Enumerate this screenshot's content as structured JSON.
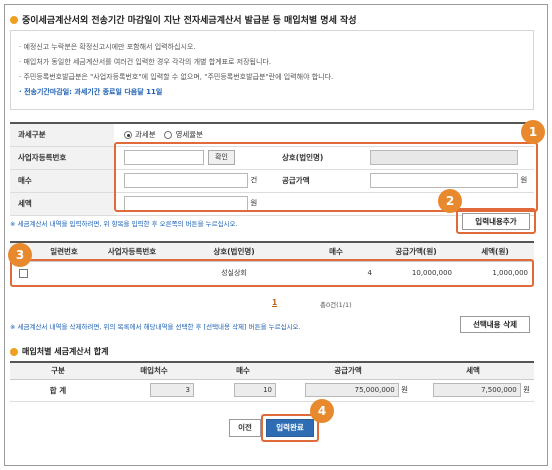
{
  "page_title": "중이세금계산서외 전송기간 마감일이 지난 전자세금계산서 발급분 등 매입처별 명세 작성",
  "notice": [
    "· 예정신고 누락분은 확정신고시에만 포함해서 입력하십시오.",
    "· 매입처가 동일한 세금계산서를 여러건 입력한 경우 각각의 개별 합계표로 저장됩니다.",
    "· 주민등록번호발급분은 \"사업자등록번호\"에 입력할 수 없으며, \"주민등록번호발급분\"란에 입력해야 합니다.",
    "· 전송기간마감일: 과세기간 종료일 다음달 11일"
  ],
  "form": {
    "tax_type_label": "과세구분",
    "tax_opt1": "과세분",
    "tax_opt2": "영세율분",
    "biz_no_label": "사업자등록번호",
    "confirm_btn": "확인",
    "company_label": "상호(법인명)",
    "count_label": "매수",
    "count_unit": "건",
    "supply_label": "공급가액",
    "supply_unit": "원",
    "tax_label": "세액",
    "tax_unit": "원"
  },
  "hint_add": "※ 세금계산서 내역을 입력하려면, 위 항목을 입력한 후 오른쪽의 버튼을 누르십시오.",
  "add_button": "입력내용추가",
  "list": {
    "headers": [
      "",
      "일련번호",
      "사업자등록번호",
      "상호(법인명)",
      "매수",
      "공급가액(원)",
      "세액(원)"
    ],
    "rows": [
      {
        "serial": "",
        "biz_no": "",
        "company": "성실상회",
        "count": "4",
        "supply": "10,000,000",
        "tax": "1,000,000"
      }
    ]
  },
  "pager_page": "1",
  "total_count": "총0건(1/1)",
  "hint_delete": "※ 세금계산서 내역을 삭제하려면, 위의 목록에서 해당내역을 선택한 후 [선택내용 삭제] 버튼을 누르십시오.",
  "delete_button": "선택내용 삭제",
  "summary": {
    "title": "매입처별 세금계산서 합계",
    "headers": [
      "구분",
      "매입처수",
      "매수",
      "공급가액",
      "세액"
    ],
    "row_label": "합 계",
    "vendors": "3",
    "count": "10",
    "supply": "75,000,000",
    "supply_unit": "원",
    "tax": "7,500,000",
    "tax_unit": "원"
  },
  "prev_button": "이전",
  "done_button": "입력완료",
  "badges": [
    "1",
    "2",
    "3",
    "4"
  ],
  "colors": {
    "accent": "#e8892e",
    "primary_button": "#2e6db4",
    "notice_blue": "#1c5fb3"
  }
}
